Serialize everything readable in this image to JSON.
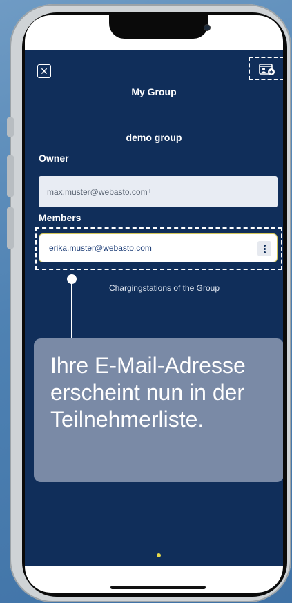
{
  "header": {
    "title": "My Group",
    "close_icon": "close-icon",
    "add_icon": "add-group-member-icon"
  },
  "group": {
    "name": "demo group"
  },
  "owner": {
    "label": "Owner",
    "email": "max.muster@webasto.com"
  },
  "members": {
    "label": "Members",
    "items": [
      {
        "email": "erika.muster@webasto.com"
      }
    ]
  },
  "charging_link": "Chargingstations of the Group",
  "callout": {
    "text": "Ihre E-Mail-Adresse erscheint nun in der Teilnehmerliste."
  },
  "colors": {
    "app_background": "#102e5a",
    "callout_background": "#7a8aa6",
    "member_border": "#d4c65a",
    "page_indicator": "#e6d84a"
  }
}
